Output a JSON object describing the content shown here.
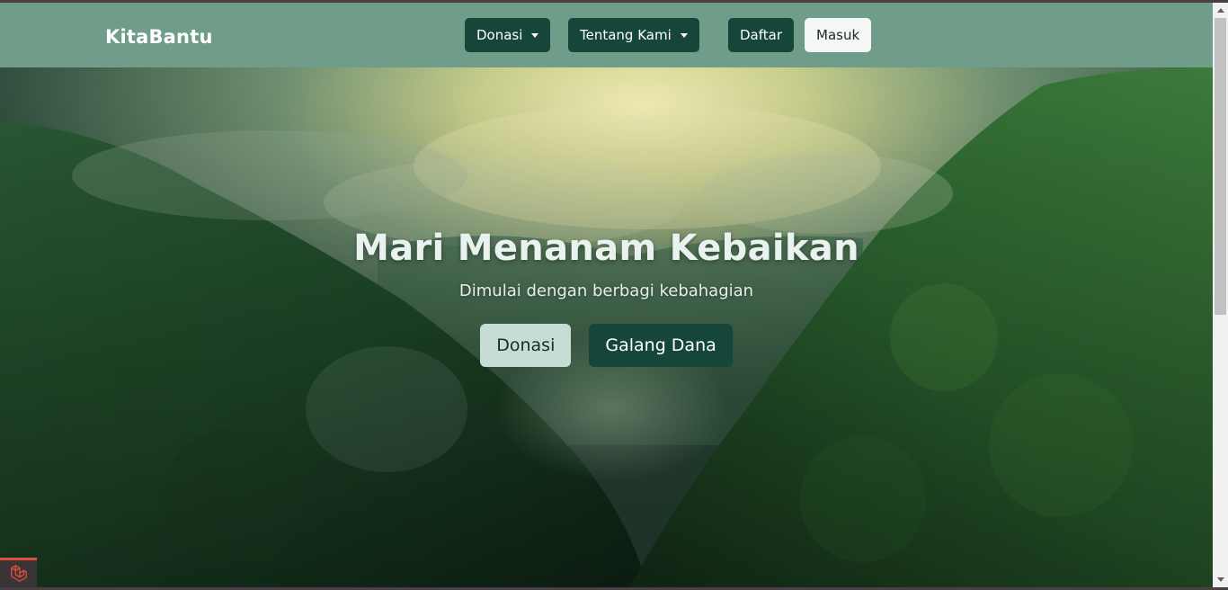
{
  "navbar": {
    "brand": "KitaBantu",
    "donasi_label": "Donasi",
    "tentang_label": "Tentang Kami",
    "daftar_label": "Daftar",
    "masuk_label": "Masuk"
  },
  "hero": {
    "title": "Mari Menanam Kebaikan",
    "subtitle": "Dimulai dengan berbagi kebahagian",
    "donasi_button": "Donasi",
    "galang_button": "Galang Dana"
  },
  "icons": {
    "dropdown": "chevron-down-icon",
    "debug": "laravel-logo-icon"
  },
  "colors": {
    "navbar_bg": "#6f9d8a",
    "primary_dark": "#16463a",
    "light_button": "#f4f7f5",
    "hero_light_button": "#c5ddd4",
    "debug_accent": "#e04f3b"
  }
}
